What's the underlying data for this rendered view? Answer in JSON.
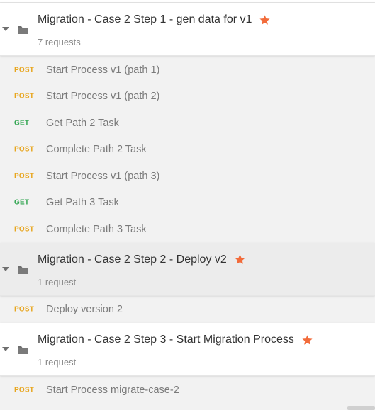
{
  "collections": [
    {
      "title": "Migration - Case 2 Step 1 - gen data for v1",
      "count": "7 requests",
      "starred": true,
      "requests": [
        {
          "method": "POST",
          "name": "Start Process v1 (path 1)"
        },
        {
          "method": "POST",
          "name": "Start Process v1 (path 2)"
        },
        {
          "method": "GET",
          "name": "Get Path 2 Task"
        },
        {
          "method": "POST",
          "name": "Complete Path 2 Task"
        },
        {
          "method": "POST",
          "name": "Start Process v1 (path 3)"
        },
        {
          "method": "GET",
          "name": "Get Path 3 Task"
        },
        {
          "method": "POST",
          "name": "Complete Path 3 Task"
        }
      ]
    },
    {
      "title": "Migration - Case 2 Step 2 - Deploy v2",
      "count": "1 request",
      "starred": true,
      "requests": [
        {
          "method": "POST",
          "name": "Deploy version 2"
        }
      ]
    },
    {
      "title": "Migration - Case 2 Step 3 - Start Migration Process",
      "count": "1 request",
      "starred": true,
      "requests": [
        {
          "method": "POST",
          "name": "Start Process migrate-case-2"
        }
      ]
    }
  ],
  "colors": {
    "post": "#e8a51c",
    "get": "#2fa44f",
    "star": "#f26b3a"
  },
  "icons": {
    "expand": "caret-down-icon",
    "folder": "folder-icon",
    "favorite": "star-icon"
  }
}
